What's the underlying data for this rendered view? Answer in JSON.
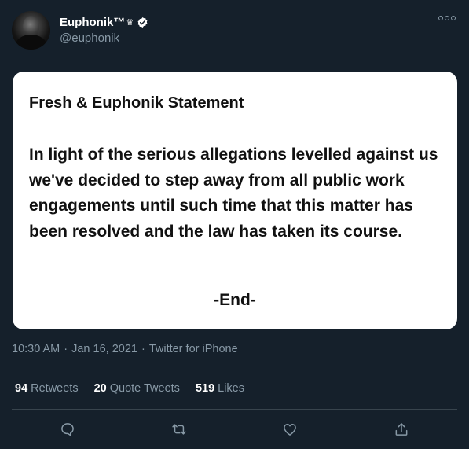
{
  "user": {
    "display_name": "Euphonik™",
    "crown_glyph": "♛",
    "handle": "@euphonik",
    "verified": true
  },
  "statement": {
    "title": "Fresh & Euphonik Statement",
    "body": "In light of the serious allegations levelled against us we've decided to step away from all public work engagements until such time that this matter has been resolved and the law has taken its course.",
    "end": "-End-"
  },
  "meta": {
    "time": "10:30 AM",
    "separator": "·",
    "date": "Jan 16, 2021",
    "source": "Twitter for iPhone"
  },
  "stats": {
    "retweets_count": "94",
    "retweets_label": "Retweets",
    "quotes_count": "20",
    "quotes_label": "Quote Tweets",
    "likes_count": "519",
    "likes_label": "Likes"
  },
  "actions": [
    "reply-icon",
    "retweet-icon",
    "like-icon",
    "share-icon"
  ],
  "colors": {
    "background": "#15202b",
    "secondary_text": "#8899a6",
    "divider": "#38444d",
    "verified_badge": "#ffffff"
  }
}
